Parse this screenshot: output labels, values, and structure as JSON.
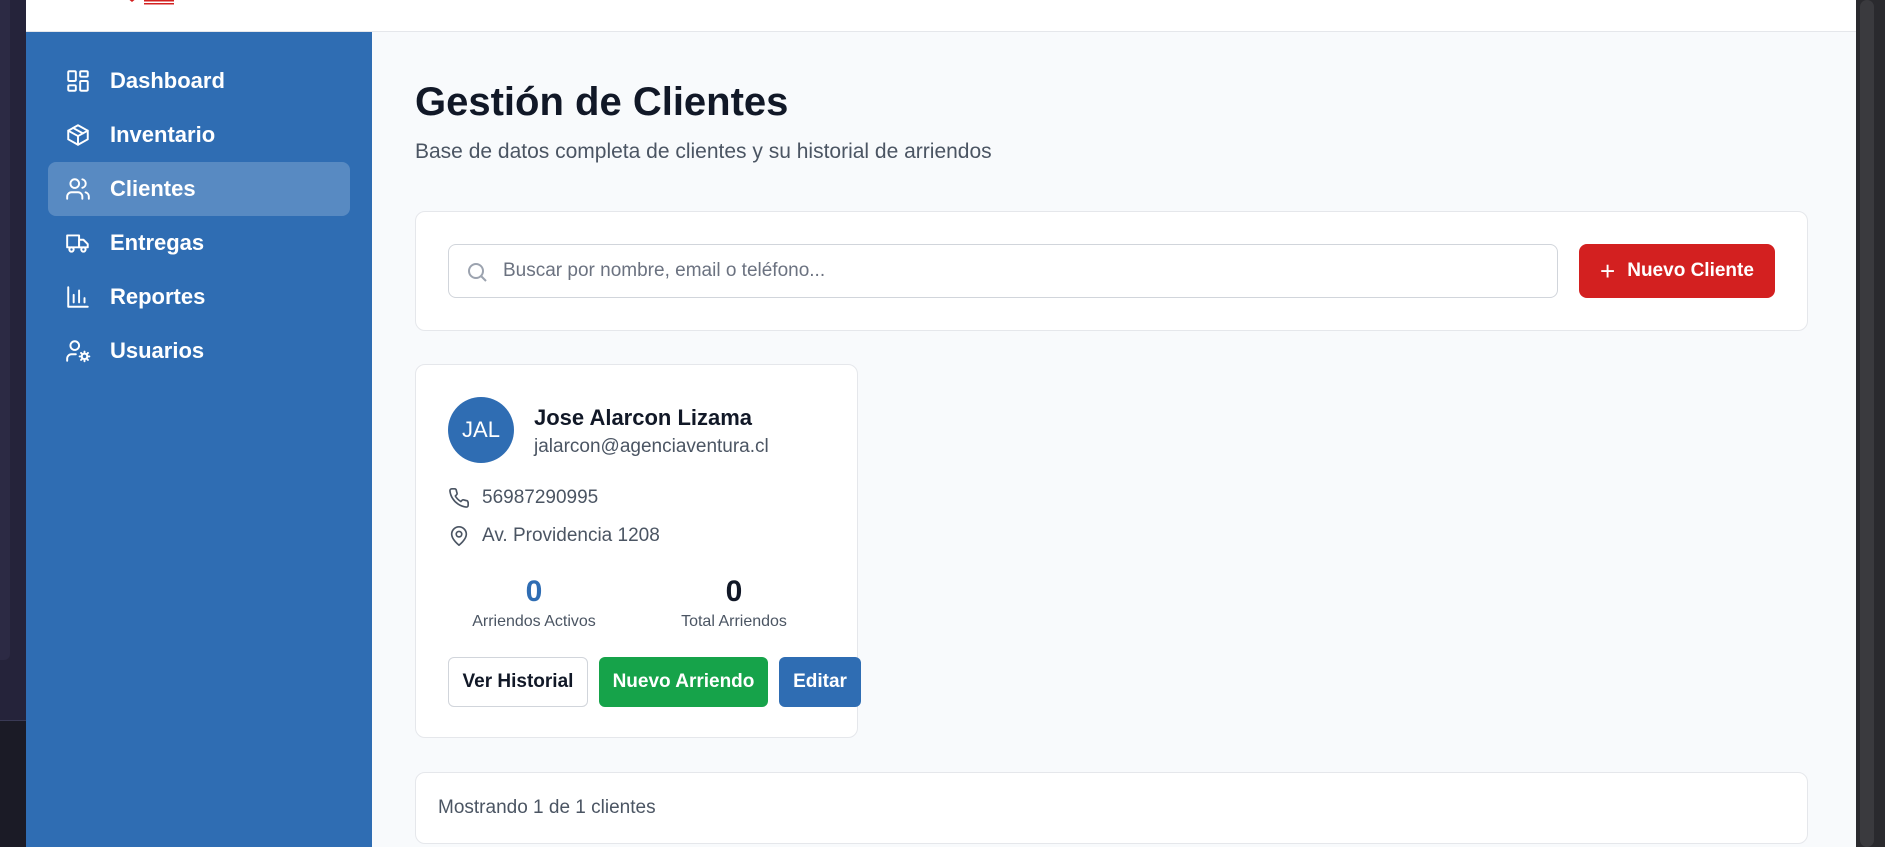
{
  "sidebar": {
    "items": [
      {
        "label": "Dashboard",
        "icon": "dashboard-icon",
        "active": false
      },
      {
        "label": "Inventario",
        "icon": "package-icon",
        "active": false
      },
      {
        "label": "Clientes",
        "icon": "users-icon",
        "active": true
      },
      {
        "label": "Entregas",
        "icon": "truck-icon",
        "active": false
      },
      {
        "label": "Reportes",
        "icon": "bar-chart-icon",
        "active": false
      },
      {
        "label": "Usuarios",
        "icon": "user-cog-icon",
        "active": false
      }
    ]
  },
  "header": {
    "title": "Gestión de Clientes",
    "subtitle": "Base de datos completa de clientes y su historial de arriendos"
  },
  "search": {
    "placeholder": "Buscar por nombre, email o teléfono...",
    "value": "",
    "new_client_label": "Nuevo Cliente"
  },
  "client": {
    "initials": "JAL",
    "name": "Jose Alarcon Lizama",
    "email": "jalarcon@agenciaventura.cl",
    "phone": "56987290995",
    "address": "Av. Providencia 1208",
    "active_rentals": "0",
    "active_rentals_label": "Arriendos Activos",
    "total_rentals": "0",
    "total_rentals_label": "Total Arriendos",
    "history_label": "Ver Historial",
    "new_rental_label": "Nuevo Arriendo",
    "edit_label": "Editar"
  },
  "footer": {
    "summary": "Mostrando 1 de 1 clientes"
  },
  "colors": {
    "sidebar": "#2f6db3",
    "primary_red": "#d32020",
    "green": "#16a34a",
    "blue": "#2f6db3"
  }
}
